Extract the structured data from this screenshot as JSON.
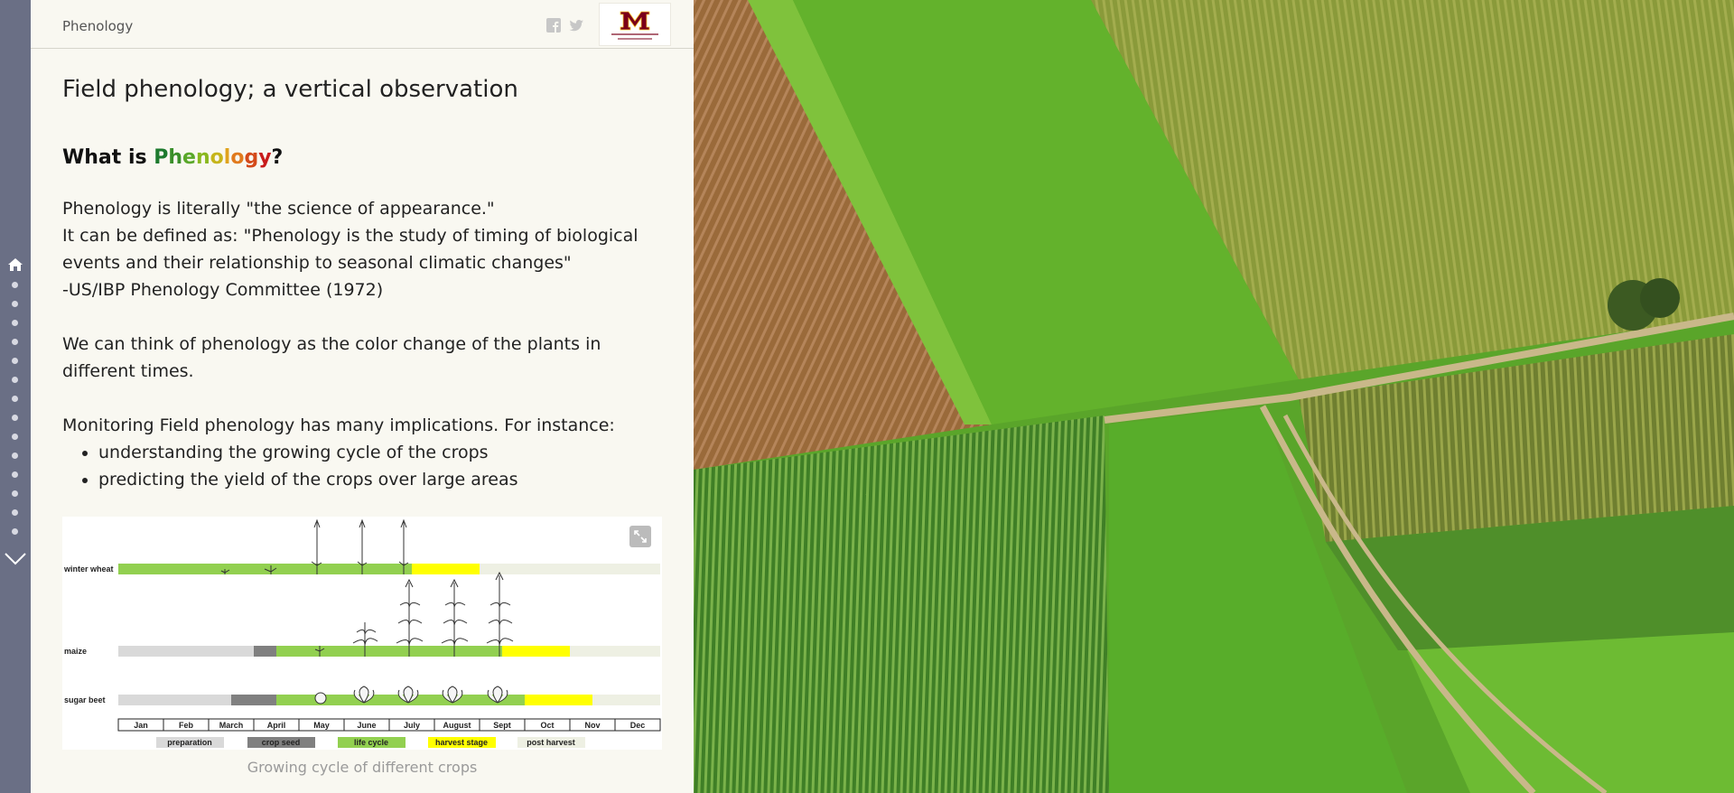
{
  "header": {
    "title": "Phenology"
  },
  "content": {
    "title": "Field phenology; a vertical observation",
    "heading_prefix": "What is ",
    "heading_word": [
      "P",
      "h",
      "e",
      "n",
      "o",
      "l",
      "o",
      "g",
      "y"
    ],
    "heading_suffix": "?",
    "para1_line1": "Phenology is literally \"the science of appearance.\"",
    "para1_line2": "It can be defined as: \"Phenology is the study of timing of biological events and their relationship to seasonal climatic changes\"",
    "para1_line3": "-US/IBP Phenology Committee (1972)",
    "para2": "We can think of phenology as the color change of the plants in different times.",
    "para3": "Monitoring Field phenology has many implications. For instance:",
    "bullets": [
      "understanding the growing cycle of the crops",
      "predicting the yield of the crops over large areas"
    ],
    "caption": "Growing cycle of different crops"
  },
  "figure": {
    "crops": [
      "winter wheat",
      "maize",
      "sugar beet"
    ],
    "months": [
      "Jan",
      "Feb",
      "March",
      "April",
      "May",
      "June",
      "July",
      "August",
      "Sept",
      "Oct",
      "Nov",
      "Dec"
    ],
    "legend": [
      "preparation",
      "crop seed",
      "life cycle",
      "harvest stage",
      "post harvest"
    ]
  },
  "colors": {
    "rail": "#6a6f85",
    "panel": "#f9f8f1",
    "preparation": "#d9d9d9",
    "crop_seed": "#808080",
    "life_cycle": "#92d050",
    "harvest": "#ffff00",
    "post_harvest": "#eef0e3"
  }
}
